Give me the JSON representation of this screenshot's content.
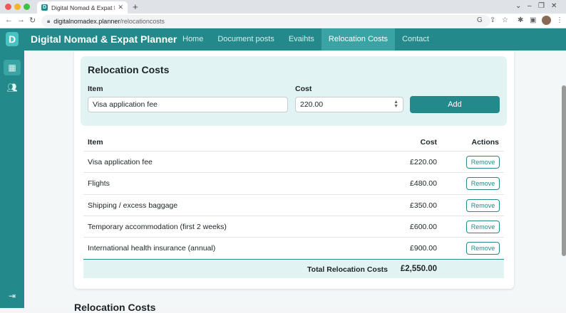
{
  "browser": {
    "tab_title": "Digital Nomad & Expat Planner",
    "tab_favicon": "D",
    "url_host": "digitalnomadex.planner",
    "url_path": "/relocationcosts",
    "icons": [
      "back-icon",
      "forward-icon",
      "reload-icon",
      "lock-icon",
      "google-icon",
      "share-icon",
      "star-icon",
      "extensions-icon",
      "sidepanel-icon",
      "profile-avatar",
      "menu-icon"
    ]
  },
  "app": {
    "logo_letter": "D",
    "brand": "Digital Nomad & Expat Planner",
    "nav": [
      {
        "label": "Home"
      },
      {
        "label": "Document posts"
      },
      {
        "label": "Evaihts"
      },
      {
        "label": "Relocation Costs"
      },
      {
        "label": "Contact"
      }
    ],
    "active_nav": "Relocation Costs",
    "accent_color": "#23898b",
    "light_accent": "#e2f3f3"
  },
  "form": {
    "title": "Relocation Costs",
    "item_label": "Item",
    "item_value": "Visa application fee",
    "cost_label": "Cost",
    "cost_value": "220.00",
    "add_label": "Add"
  },
  "table": {
    "headers": {
      "item": "Item",
      "cost": "Cost",
      "actions": "Actions"
    },
    "rows": [
      {
        "item": "Visa application fee",
        "cost": "£220.00",
        "action": "Remove"
      },
      {
        "item": "Flights",
        "cost": "£480.00",
        "action": "Remove"
      },
      {
        "item": "Shipping / excess baggage",
        "cost": "£350.00",
        "action": "Remove"
      },
      {
        "item": "Temporary accommodation (first 2 weeks)",
        "cost": "£600.00",
        "action": "Remove"
      },
      {
        "item": "International health insurance (annual)",
        "cost": "£900.00",
        "action": "Remove"
      }
    ],
    "total_label": "Total Relocation Costs",
    "total_value": "£2,550.00"
  },
  "below_fold_title": "Relocation Costs"
}
